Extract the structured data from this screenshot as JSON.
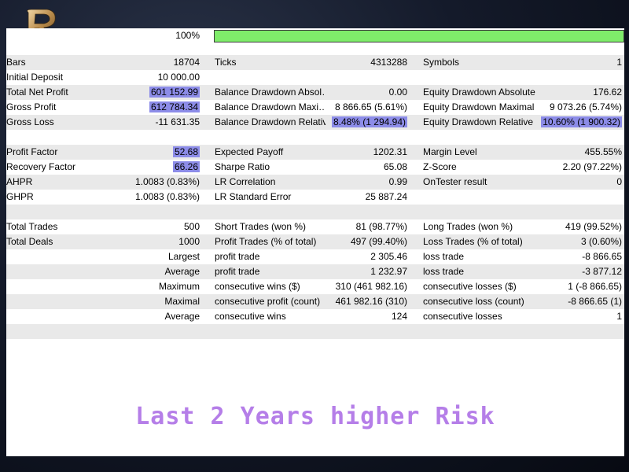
{
  "progress": {
    "label": "100%",
    "value_percent": 100,
    "bar_color": "#7fec6a"
  },
  "rows": [
    {
      "type": "stats",
      "alt": true,
      "cells": [
        {
          "label": "Bars",
          "value": "18704"
        },
        {
          "label": "Ticks",
          "value": "4313288"
        },
        {
          "label": "Symbols",
          "value": "1"
        }
      ]
    },
    {
      "type": "stats",
      "alt": false,
      "cells": [
        {
          "label": "Initial Deposit",
          "value": "10 000.00"
        },
        {
          "label": "",
          "value": ""
        },
        {
          "label": "",
          "value": ""
        }
      ]
    },
    {
      "type": "stats",
      "alt": true,
      "cells": [
        {
          "label": "Total Net Profit",
          "value": "601 152.99",
          "highlight": true
        },
        {
          "label": "Balance Drawdown Absol…",
          "value": "0.00"
        },
        {
          "label": "Equity Drawdown Absolute",
          "value": "176.62"
        }
      ]
    },
    {
      "type": "stats",
      "alt": false,
      "cells": [
        {
          "label": "Gross Profit",
          "value": "612 784.34",
          "highlight": true
        },
        {
          "label": "Balance Drawdown Maxi…",
          "value": "8 866.65 (5.61%)"
        },
        {
          "label": "Equity Drawdown Maximal",
          "value": "9 073.26 (5.74%)"
        }
      ]
    },
    {
      "type": "stats",
      "alt": true,
      "cells": [
        {
          "label": "Gross Loss",
          "value": "-11 631.35"
        },
        {
          "label": "Balance Drawdown Relative",
          "value": "8.48% (1 294.94)",
          "highlight": true
        },
        {
          "label": "Equity Drawdown Relative",
          "value": "10.60% (1 900.32)",
          "highlight": true
        }
      ]
    },
    {
      "type": "empty",
      "alt": false
    },
    {
      "type": "stats",
      "alt": true,
      "cells": [
        {
          "label": "Profit Factor",
          "value": "52.68",
          "highlight": true
        },
        {
          "label": "Expected Payoff",
          "value": "1202.31"
        },
        {
          "label": "Margin Level",
          "value": "455.55%"
        }
      ]
    },
    {
      "type": "stats",
      "alt": false,
      "cells": [
        {
          "label": "Recovery Factor",
          "value": "66.26",
          "highlight": true
        },
        {
          "label": "Sharpe Ratio",
          "value": "65.08"
        },
        {
          "label": "Z-Score",
          "value": "2.20 (97.22%)"
        }
      ]
    },
    {
      "type": "stats",
      "alt": true,
      "cells": [
        {
          "label": "AHPR",
          "value": "1.0083 (0.83%)"
        },
        {
          "label": "LR Correlation",
          "value": "0.99"
        },
        {
          "label": "OnTester result",
          "value": "0"
        }
      ]
    },
    {
      "type": "stats",
      "alt": false,
      "cells": [
        {
          "label": "GHPR",
          "value": "1.0083 (0.83%)"
        },
        {
          "label": "LR Standard Error",
          "value": "25 887.24"
        },
        {
          "label": "",
          "value": ""
        }
      ]
    },
    {
      "type": "empty",
      "alt": true
    },
    {
      "type": "stats",
      "alt": false,
      "cells": [
        {
          "label": "Total Trades",
          "value": "500"
        },
        {
          "label": "Short Trades (won %)",
          "value": "81 (98.77%)"
        },
        {
          "label": "Long Trades (won %)",
          "value": "419 (99.52%)"
        }
      ]
    },
    {
      "type": "stats",
      "alt": true,
      "cells": [
        {
          "label": "Total Deals",
          "value": "1000"
        },
        {
          "label": "Profit Trades (% of total)",
          "value": "497 (99.40%)"
        },
        {
          "label": "Loss Trades (% of total)",
          "value": "3 (0.60%)"
        }
      ]
    },
    {
      "type": "trades",
      "alt": false,
      "head": "Largest",
      "cells": [
        {
          "label": "profit trade",
          "value": "2 305.46"
        },
        {
          "label": "loss trade",
          "value": "-8 866.65"
        }
      ]
    },
    {
      "type": "trades",
      "alt": true,
      "head": "Average",
      "cells": [
        {
          "label": "profit trade",
          "value": "1 232.97"
        },
        {
          "label": "loss trade",
          "value": "-3 877.12"
        }
      ]
    },
    {
      "type": "trades",
      "alt": false,
      "head": "Maximum",
      "cells": [
        {
          "label": "consecutive wins ($)",
          "value": "310 (461 982.16)"
        },
        {
          "label": "consecutive losses ($)",
          "value": "1 (-8 866.65)"
        }
      ]
    },
    {
      "type": "trades",
      "alt": true,
      "head": "Maximal",
      "cells": [
        {
          "label": "consecutive profit (count)",
          "value": "461 982.16 (310)"
        },
        {
          "label": "consecutive loss (count)",
          "value": "-8 866.65 (1)"
        }
      ]
    },
    {
      "type": "trades",
      "alt": false,
      "head": "Average",
      "cells": [
        {
          "label": "consecutive wins",
          "value": "124"
        },
        {
          "label": "consecutive losses",
          "value": "1"
        }
      ]
    },
    {
      "type": "empty",
      "alt": true
    }
  ],
  "footer": {
    "text": "Last 2 Years higher Risk",
    "color": "#b57ee8"
  },
  "colors": {
    "highlight": "#8c8ce8",
    "row_alt": "#e9e9e9"
  },
  "logo": {
    "icon": "logo-icon",
    "letter": "R"
  }
}
